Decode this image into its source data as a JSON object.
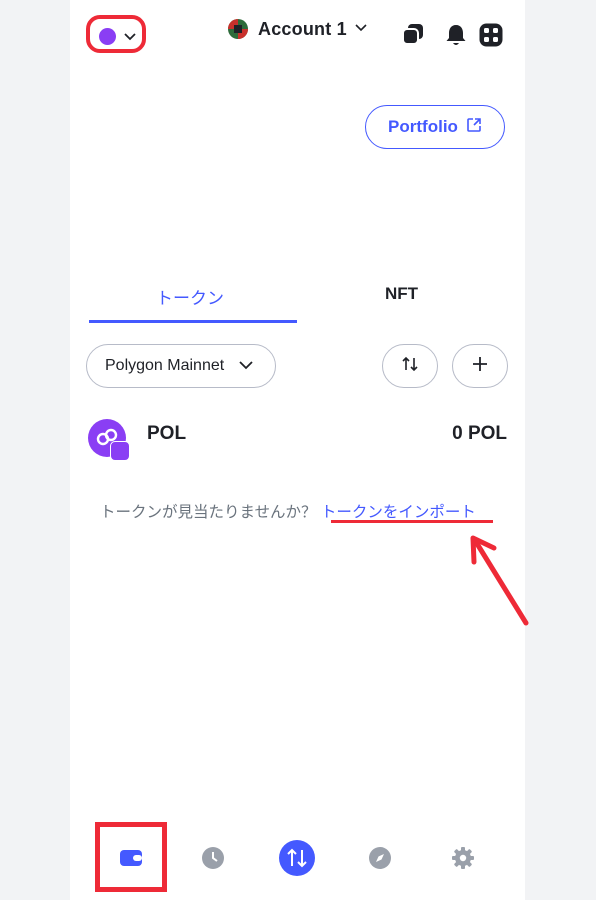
{
  "header": {
    "account_name": "Account 1",
    "network_icon": "polygon-icon",
    "icons": [
      "copy-icon",
      "bell-icon",
      "apps-grid-icon"
    ]
  },
  "portfolio": {
    "label": "Portfolio"
  },
  "tabs": {
    "tokens": "トークン",
    "nft": "NFT"
  },
  "filter": {
    "network": "Polygon Mainnet"
  },
  "tokens": [
    {
      "symbol": "POL",
      "balance": "0 POL"
    }
  ],
  "import": {
    "prompt": "トークンが見当たりませんか？",
    "link": "トークンをインポート"
  },
  "bottom_nav": [
    "wallet-icon",
    "clock-icon",
    "swap-icon",
    "explore-icon",
    "settings-icon"
  ],
  "colors": {
    "accent": "#4459ff",
    "polygon": "#8a3ef4",
    "highlight": "#ee2a37"
  }
}
